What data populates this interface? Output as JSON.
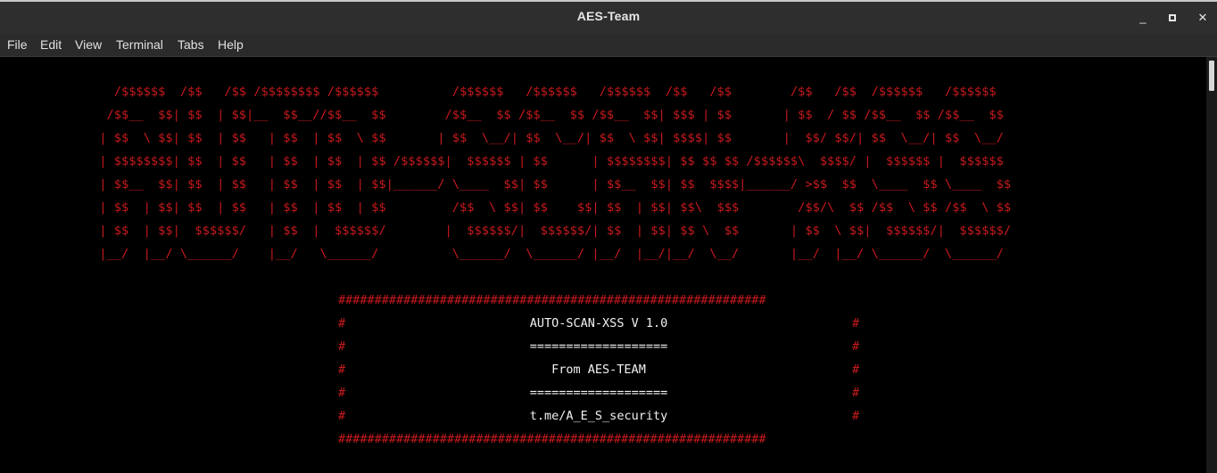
{
  "window": {
    "title": "AES-Team",
    "minimize_symbol": "_",
    "maximize_symbol": "▫",
    "close_symbol": "✕"
  },
  "menu": {
    "items": [
      "File",
      "Edit",
      "View",
      "Terminal",
      "Tabs",
      "Help"
    ]
  },
  "terminal": {
    "text_color": "#c8191c",
    "banner": [
      "   /$$$$$$  /$$   /$$ /$$$$$$$$ /$$$$$$          /$$$$$$   /$$$$$$   /$$$$$$  /$$   /$$        /$$   /$$  /$$$$$$   /$$$$$$",
      "  /$$__  $$| $$  | $$|__  $$__//$$__  $$        /$$__  $$ /$$__  $$ /$$__  $$| $$$ | $$       | $$  / $$ /$$__  $$ /$$__  $$",
      " | $$  \\ $$| $$  | $$   | $$  | $$  \\ $$       | $$  \\__/| $$  \\__/| $$  \\ $$| $$$$| $$       |  $$/ $$/| $$  \\__/| $$  \\__/",
      " | $$$$$$$$| $$  | $$   | $$  | $$  | $$ /$$$$$$|  $$$$$$ | $$      | $$$$$$$$| $$ $$ $$ /$$$$$$\\  $$$$/ |  $$$$$$ |  $$$$$$",
      " | $$__  $$| $$  | $$   | $$  | $$  | $$|______/ \\____  $$| $$      | $$__  $$| $$  $$$$|______/ >$$  $$  \\____  $$ \\____  $$",
      " | $$  | $$| $$  | $$   | $$  | $$  | $$         /$$  \\ $$| $$    $$| $$  | $$| $$\\  $$$        /$$/\\  $$ /$$  \\ $$ /$$  \\ $$",
      " | $$  | $$|  $$$$$$/   | $$  |  $$$$$$/        |  $$$$$$/|  $$$$$$/| $$  | $$| $$ \\  $$       | $$  \\ $$|  $$$$$$/|  $$$$$$/",
      " |__/  |__/ \\______/    |__/   \\______/          \\______/  \\______/ |__/  |__/|__/  \\__/       |__/  |__/ \\______/  \\______/"
    ],
    "box_border": "###########################################################",
    "box_edge": "#",
    "box_lines": [
      "AUTO-SCAN-XSS V 1.0",
      "===================",
      "From AES-TEAM",
      "===================",
      "t.me/A_E_S_security"
    ]
  }
}
